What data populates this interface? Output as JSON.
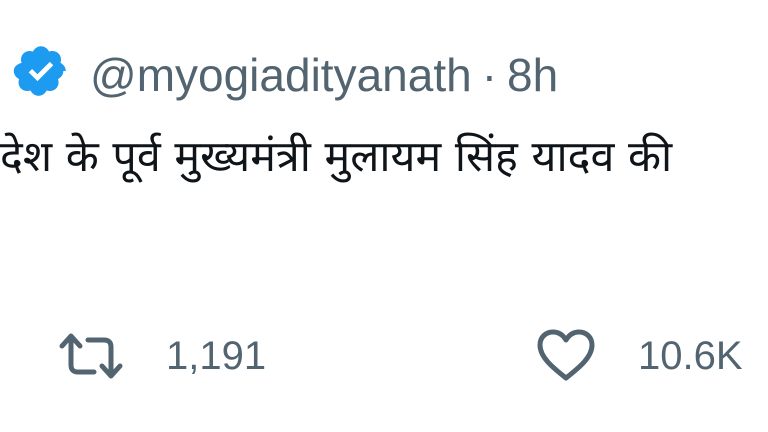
{
  "tweet": {
    "handle": "@myogiadityanath",
    "separator": "·",
    "time": "8h",
    "text": "देश के पूर्व मुख्यमंत्री मुलायम सिंह यादव की",
    "badge_icon": "verified-badge-icon",
    "badge_color": "#1d9bf0"
  },
  "actions": {
    "retweet": {
      "icon": "retweet-icon",
      "count": "1,191"
    },
    "like": {
      "icon": "heart-icon",
      "count": "10.6K"
    }
  },
  "colors": {
    "secondary_text": "#536471",
    "primary_text": "#0f1419"
  }
}
